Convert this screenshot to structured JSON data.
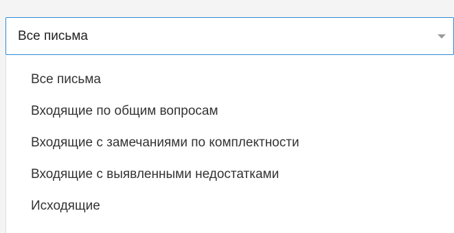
{
  "dropdown": {
    "selected_value": "Все письма",
    "caret_icon": "chevron-down-icon",
    "accent_color": "#2b8ad4",
    "options": [
      {
        "label": "Все письма"
      },
      {
        "label": "Входящие по общим вопросам"
      },
      {
        "label": "Входящие с замечаниями по комплектности"
      },
      {
        "label": "Входящие с выявленными недостатками"
      },
      {
        "label": "Исходящие"
      }
    ]
  }
}
